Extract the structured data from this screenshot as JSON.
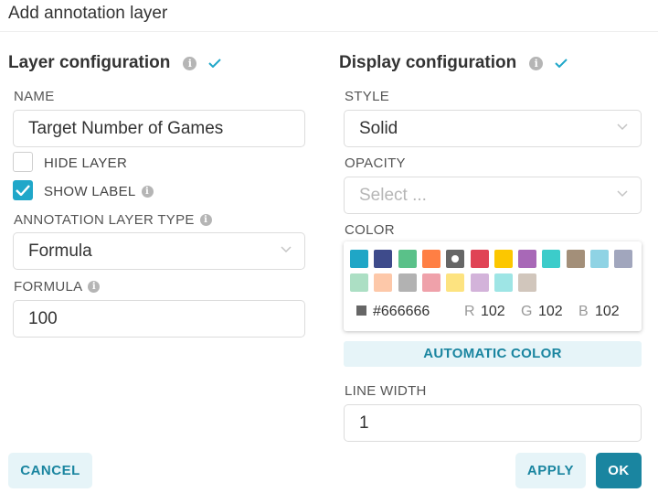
{
  "dialog": {
    "title": "Add annotation layer"
  },
  "layer_config": {
    "heading": "Layer configuration",
    "name_label": "NAME",
    "name_value": "Target Number of Games",
    "hide_layer_label": "HIDE LAYER",
    "hide_layer_checked": false,
    "show_label_label": "SHOW LABEL",
    "show_label_checked": true,
    "type_label": "ANNOTATION LAYER TYPE",
    "type_value": "Formula",
    "formula_label": "FORMULA",
    "formula_value": "100"
  },
  "display_config": {
    "heading": "Display configuration",
    "style_label": "STYLE",
    "style_value": "Solid",
    "opacity_label": "OPACITY",
    "opacity_placeholder": "Select ...",
    "color_label": "COLOR",
    "swatches_row1": [
      "#1fa6c6",
      "#3e4b8b",
      "#5ac189",
      "#ff7f44",
      "#666666",
      "#e04355",
      "#fcc700",
      "#a868b7",
      "#3cccca",
      "#a38f79",
      "#8fd3e4",
      "#a1a6bd"
    ],
    "swatches_row2": [
      "#acdfc4",
      "#fdc8a9",
      "#b2b2b2",
      "#efa1aa",
      "#fde380",
      "#d3b3da",
      "#9ee5e5",
      "#d1c6bc"
    ],
    "selected_swatch_index": 4,
    "hex_value": "#666666",
    "r_label": "R",
    "r_value": "102",
    "g_label": "G",
    "g_value": "102",
    "b_label": "B",
    "b_value": "102",
    "automatic_color_label": "AUTOMATIC COLOR",
    "line_width_label": "LINE WIDTH",
    "line_width_value": "1"
  },
  "footer": {
    "cancel_label": "CANCEL",
    "apply_label": "APPLY",
    "ok_label": "OK"
  },
  "colors": {
    "accent": "#1a85a0",
    "check": "#20a7c9"
  },
  "icons": {
    "info": "info-icon",
    "check": "checkmark-icon",
    "chevron": "chevron-down-icon"
  }
}
